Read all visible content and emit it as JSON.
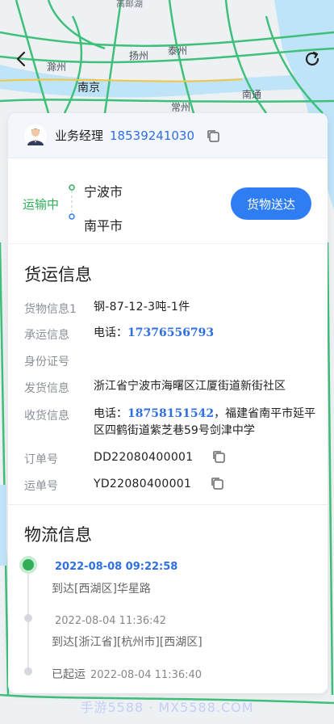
{
  "map": {
    "labels": {
      "top_cut": "高邮湖",
      "chuzhou": "滁州",
      "yangzhou": "扬州",
      "taizhou": "泰州",
      "nanjing": "南京",
      "nantong": "南通",
      "changzhou": "常州"
    }
  },
  "header": {
    "back_icon": "chevron-left-icon",
    "refresh_icon": "refresh-icon"
  },
  "manager": {
    "label": "业务经理",
    "phone": "18539241030"
  },
  "route": {
    "status": "运输中",
    "from": "宁波市",
    "to": "南平市",
    "action": "货物送达"
  },
  "cargo": {
    "title": "货运信息",
    "rows": [
      {
        "label": "货物信息1",
        "value": "钢-87-12-3吨-1件"
      },
      {
        "label": "承运信息",
        "prefix": "电话：",
        "phone": "17376556793"
      },
      {
        "label": "身份证号",
        "value": ""
      },
      {
        "label": "发货信息",
        "value": "浙江省宁波市海曙区江厦街道新街社区"
      },
      {
        "label": "收货信息",
        "prefix": "电话：",
        "phone": "18758151542",
        "value": "，福建省南平市延平区四鹤街道紫芝巷59号剑津中学"
      },
      {
        "label": "订单号",
        "value": "DD22080400001"
      },
      {
        "label": "运单号",
        "value": "YD22080400001"
      }
    ]
  },
  "logistics": {
    "title": "物流信息",
    "events": [
      {
        "time": "2022-08-08 09:22:58",
        "desc": "到达[西湖区]华星路"
      },
      {
        "time": "2022-08-04 11:36:42",
        "desc": "到达[浙江省][杭州市][西湖区]"
      }
    ],
    "start_label": "已起运",
    "start_time": "2022-08-04 11:36:40"
  },
  "watermark": "手游5588 · MX5588.COM",
  "colors": {
    "accent": "#2f7df2",
    "status_green": "#2eaf58",
    "link_blue": "#2f6fe4"
  }
}
